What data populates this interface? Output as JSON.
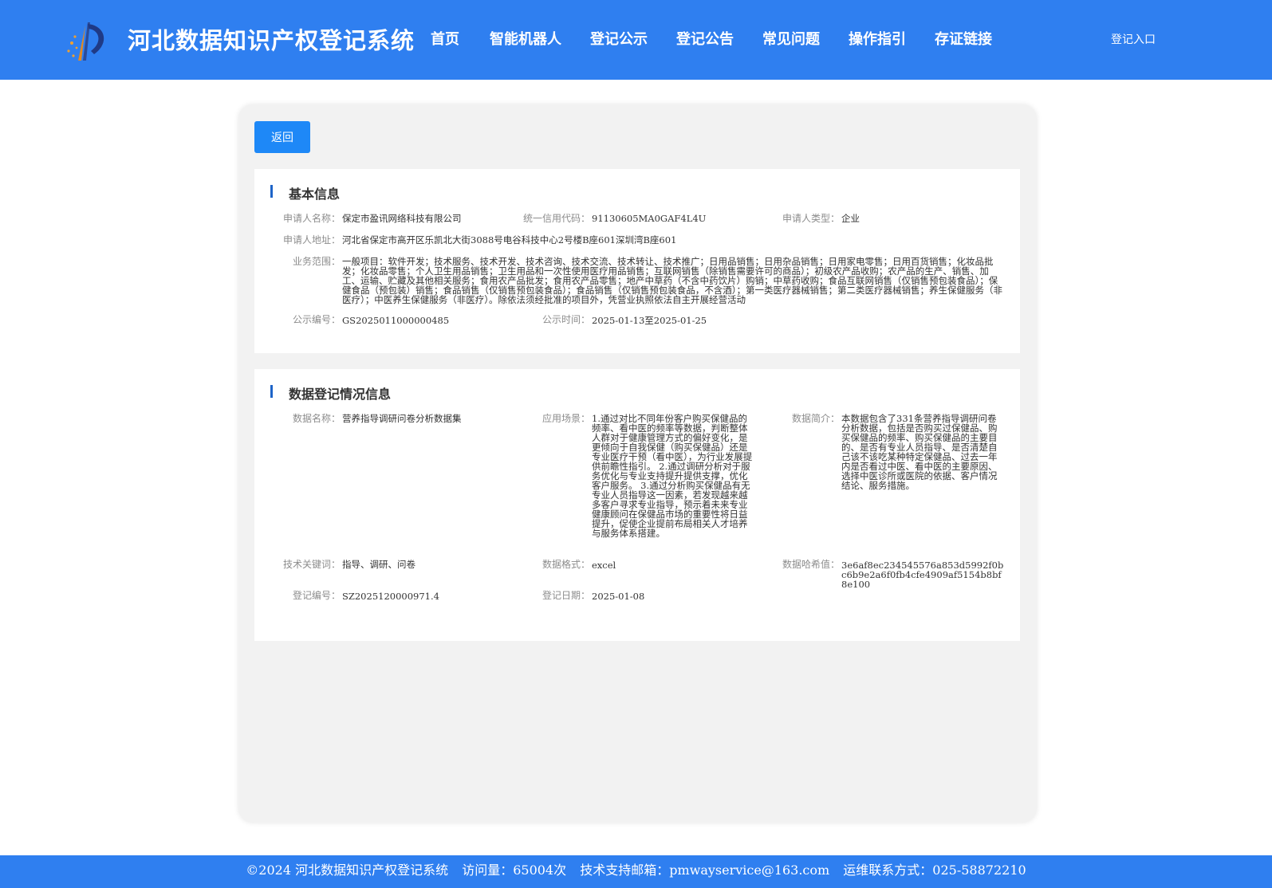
{
  "header": {
    "title": "河北数据知识产权登记系统",
    "nav": [
      "首页",
      "智能机器人",
      "登记公示",
      "登记公告",
      "常见问题",
      "操作指引",
      "存证链接"
    ],
    "login": "登记入口"
  },
  "actions": {
    "back": "返回"
  },
  "basic": {
    "title": "基本信息",
    "applicant_name_label": "申请人名称：",
    "applicant_name": "保定市盈讯网络科技有限公司",
    "credit_code_label": "统一信用代码：",
    "credit_code": "91130605MA0GAF4L4U",
    "applicant_type_label": "申请人类型：",
    "applicant_type": "企业",
    "address_label": "申请人地址：",
    "address": "河北省保定市高开区乐凯北大街3088号电谷科技中心2号楼B座601深圳湾B座601",
    "scope_label": "业务范围：",
    "scope": "一般项目：软件开发；技术服务、技术开发、技术咨询、技术交流、技术转让、技术推广；日用品销售；日用杂品销售；日用家电零售；日用百货销售；化妆品批发；化妆品零售；个人卫生用品销售；卫生用品和一次性使用医疗用品销售；互联网销售（除销售需要许可的商品）；初级农产品收购；农产品的生产、销售、加工、运输、贮藏及其他相关服务；食用农产品批发；食用农产品零售；地产中草药（不含中药饮片）购销；中草药收购；食品互联网销售（仅销售预包装食品）；保健食品（预包装）销售；食品销售（仅销售预包装食品）；食品销售（仅销售预包装食品，不含酒）；第一类医疗器械销售；第二类医疗器械销售；养生保健服务（非医疗）；中医养生保健服务（非医疗）。除依法须经批准的项目外，凭营业执照依法自主开展经营活动",
    "notice_no_label": "公示编号：",
    "notice_no": "GS2025011000000485",
    "notice_time_label": "公示时间：",
    "notice_time": "2025-01-13至2025-01-25"
  },
  "data_reg": {
    "title": "数据登记情况信息",
    "name_label": "数据名称：",
    "name": "营养指导调研问卷分析数据集",
    "scene_label": "应用场景：",
    "scene": "1.通过对比不同年份客户购买保健品的频率、看中医的频率等数据，判断整体人群对于健康管理方式的偏好变化，是更倾向于自我保健（购买保健品）还是专业医疗干预（看中医），为行业发展提供前瞻性指引。 2.通过调研分析对于服务优化与专业支持提升提供支撑，优化客户服务。 3.通过分析购买保健品有无专业人员指导这一因素，若发现越来越多客户寻求专业指导，预示着未来专业健康顾问在保健品市场的重要性将日益提升，促使企业提前布局相关人才培养与服务体系搭建。",
    "intro_label": "数据简介：",
    "intro": "本数据包含了331条营养指导调研问卷分析数据，包括是否购买过保健品、购买保健品的频率、购买保健品的主要目的、是否有专业人员指导、是否清楚自己该不该吃某种特定保健品、过去一年内是否看过中医、看中医的主要原因、选择中医诊所或医院的依据、客户情况结论、服务措施。",
    "keywords_label": "技术关键词：",
    "keywords": "指导、调研、问卷",
    "format_label": "数据格式：",
    "format": "excel",
    "hash_label": "数据哈希值：",
    "hash": "3e6af8ec234545576a853d5992f0bc6b9e2a6f0fb4cfe4909af5154b8bf8e100",
    "reg_no_label": "登记编号：",
    "reg_no": "SZ2025120000971.4",
    "reg_date_label": "登记日期：",
    "reg_date": "2025-01-08"
  },
  "footer": {
    "copyright": "©2024 河北数据知识产权登记系统",
    "visits": "访问量：65004次",
    "email": "技术支持邮箱：pmwayservice@163.com",
    "phone": "运维联系方式：025-58872210"
  }
}
